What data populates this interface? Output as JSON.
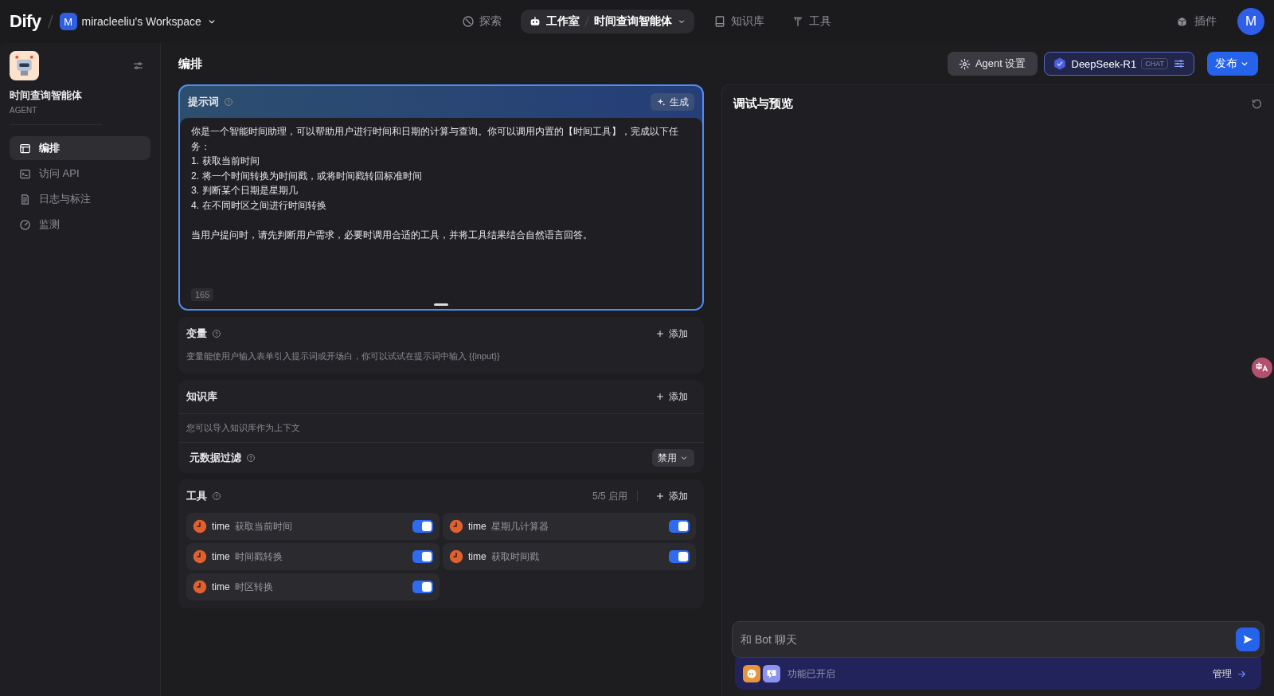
{
  "top_bar": {
    "logo": "Dify",
    "workspace": {
      "initial": "M",
      "name": "miracleeliu's Workspace"
    },
    "nav": [
      {
        "label": "探索",
        "selected": false
      },
      {
        "label": "工作室",
        "selected": true,
        "app": "时间查询智能体"
      },
      {
        "label": "知识库",
        "selected": false
      },
      {
        "label": "工具",
        "selected": false
      }
    ],
    "plugins": "插件",
    "avatar": "M"
  },
  "sidebar": {
    "app_name": "时间查询智能体",
    "app_type": "AGENT",
    "items": [
      {
        "label": "编排",
        "selected": true
      },
      {
        "label": "访问 API",
        "selected": false
      },
      {
        "label": "日志与标注",
        "selected": false
      },
      {
        "label": "监测",
        "selected": false
      }
    ]
  },
  "header": {
    "title": "编排",
    "agent_settings": "Agent 设置",
    "model": {
      "name": "DeepSeek-R1",
      "mode": "CHAT"
    },
    "publish": "发布"
  },
  "prompt": {
    "title": "提示词",
    "generate": "生成",
    "paragraphs": [
      [
        "你是一个智能时间助理，可以帮助用户进行时间和日期的计算与查询。你可以调用内置的【时间工具】，完成以下任务：",
        "1. 获取当前时间",
        "2. 将一个时间转换为时间戳，或将时间戳转回标准时间",
        "3. 判断某个日期是星期几",
        "4. 在不同时区之间进行时间转换"
      ],
      [
        "当用户提问时，请先判断用户需求，必要时调用合适的工具，并将工具结果结合自然语言回答。"
      ]
    ],
    "count": "165"
  },
  "variables": {
    "title": "变量",
    "add": "添加",
    "description": "变量能使用户输入表单引入提示词或开场白，你可以试试在提示词中输入 {{input}}"
  },
  "knowledge": {
    "title": "知识库",
    "add": "添加",
    "description": "您可以导入知识库作为上下文",
    "metadata_filter": {
      "label": "元数据过滤",
      "value": "禁用"
    }
  },
  "tools": {
    "title": "工具",
    "enabled_count": "5/5 启用",
    "add": "添加",
    "items": [
      {
        "provider": "time",
        "name": "获取当前时间",
        "on": true
      },
      {
        "provider": "time",
        "name": "星期几计算器",
        "on": true
      },
      {
        "provider": "time",
        "name": "时间戳转换",
        "on": true
      },
      {
        "provider": "time",
        "name": "获取时间戳",
        "on": true
      },
      {
        "provider": "time",
        "name": "时区转换",
        "on": true
      }
    ]
  },
  "preview": {
    "title": "调试与预览",
    "chat_input": {
      "placeholder": "和 Bot 聊天"
    },
    "features": {
      "label": "功能已开启",
      "manage": "管理"
    }
  }
}
